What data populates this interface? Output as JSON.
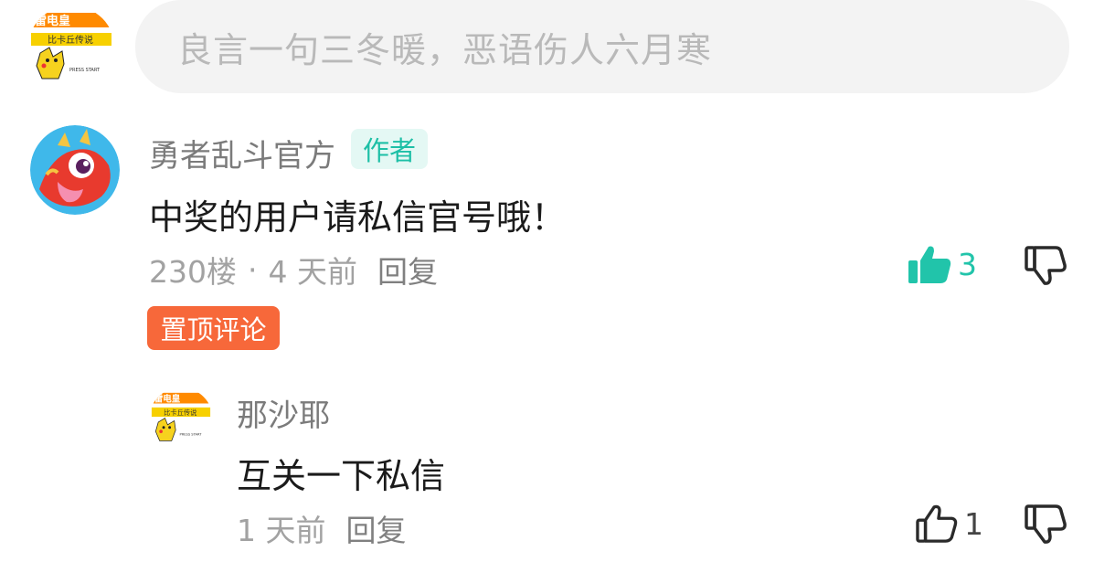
{
  "composer": {
    "placeholder": "良言一句三冬暖，恶语伤人六月寒"
  },
  "comments": [
    {
      "username": "勇者乱斗官方",
      "badge": "作者",
      "text": "中奖的用户请私信官号哦！",
      "floor": "230楼",
      "separator": "·",
      "time": "4 天前",
      "reply_label": "回复",
      "likes": "3",
      "liked": true,
      "pin_label": "置顶评论"
    },
    {
      "username": "那沙耶",
      "text": "互关一下私信",
      "time": "1 天前",
      "reply_label": "回复",
      "likes": "1",
      "liked": false
    }
  ],
  "avatar_logo": {
    "line1": "雷电皇",
    "line2": "比卡丘传说",
    "line3": "PRESS START"
  },
  "colors": {
    "accent": "#21c4aa",
    "badge_bg": "#e4f8f4",
    "pin": "#f7683a"
  },
  "icons": {
    "like": "thumbs-up-icon",
    "dislike": "thumbs-down-icon"
  }
}
